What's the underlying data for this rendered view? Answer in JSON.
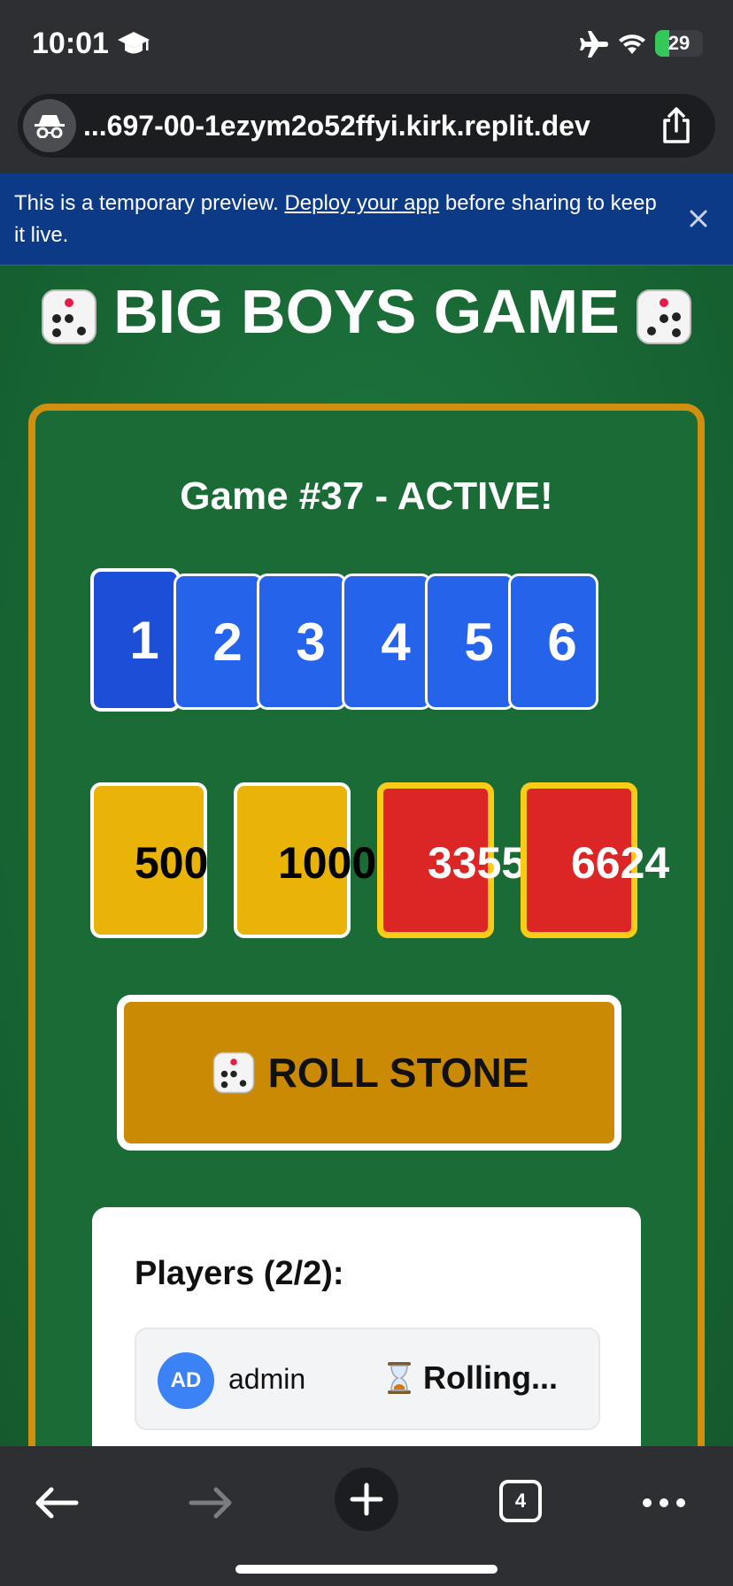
{
  "status_bar": {
    "time": "10:01",
    "battery": "29",
    "battery_level": 0.29
  },
  "browser": {
    "url": "...697-00-1ezym2o52ffyi.kirk.replit.dev",
    "tab_count": "4"
  },
  "banner": {
    "text_before": "This is a temporary preview. ",
    "link": "Deploy your app",
    "text_after": " before sharing to keep it live."
  },
  "game": {
    "title": "BIG BOYS GAME",
    "status": "Game #37 - ACTIVE!",
    "numbers": [
      "1",
      "2",
      "3",
      "4",
      "5",
      "6"
    ],
    "selected_number": "1",
    "bets": [
      {
        "value": "500",
        "color": "#eab308"
      },
      {
        "value": "1000",
        "color": "#eab308"
      },
      {
        "value": "3355",
        "color": "#dc2626"
      },
      {
        "value": "6624",
        "color": "#dc2626"
      }
    ],
    "roll_button": "ROLL STONE"
  },
  "players": {
    "title": "Players (2/2):",
    "list": [
      {
        "initials": "AD",
        "name": "admin",
        "state": "Rolling..."
      }
    ]
  },
  "colors": {
    "board_border": "#d18f10",
    "accent_blue": "#2563eb",
    "roll_button": "#ca8a04"
  }
}
